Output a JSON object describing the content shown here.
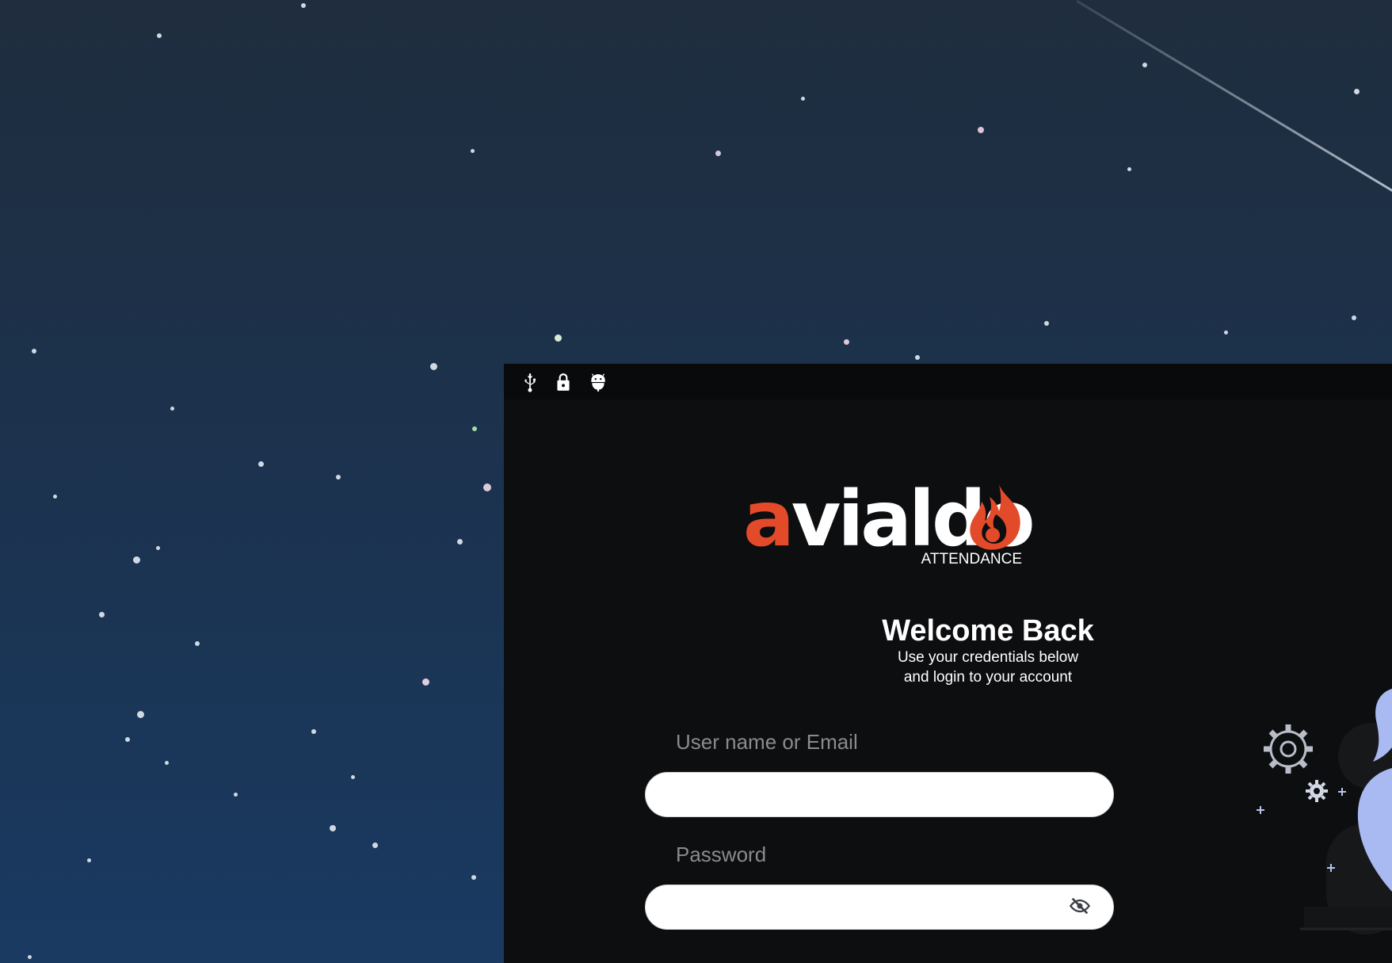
{
  "statusbar": {
    "icons": [
      "usb-icon",
      "lock-icon",
      "android-icon"
    ]
  },
  "logo": {
    "word_first": "a",
    "word_rest": "vialdo",
    "subtitle": "ATTENDANCE",
    "brand_color": "#e24a2a"
  },
  "login": {
    "title": "Welcome Back",
    "subtitle": "Use your credentials below and login to your account",
    "username_label": "User name or Email",
    "username_value": "",
    "password_label": "Password",
    "password_value": ""
  },
  "colors": {
    "window_bg": "#0d0e10",
    "statusbar_bg": "#090a0b",
    "label_gray": "#8a8b8e"
  }
}
